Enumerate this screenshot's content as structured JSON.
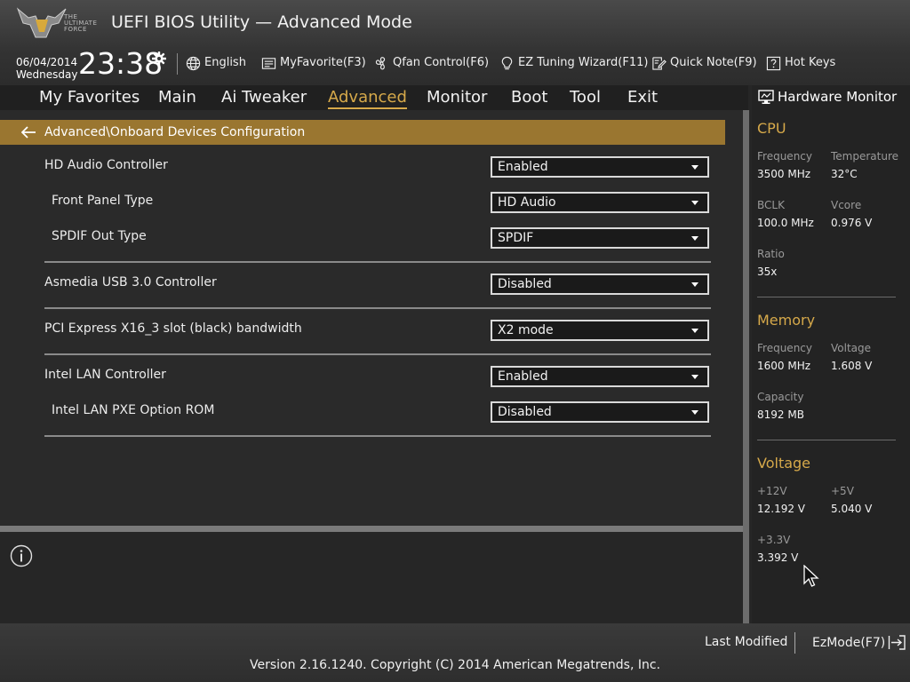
{
  "header": {
    "logo_text": [
      "THE",
      "ULTIMATE",
      "FORCE"
    ],
    "title": "UEFI BIOS Utility — Advanced Mode",
    "date": "06/04/2014",
    "weekday": "Wednesday",
    "time": "23:38",
    "buttons": {
      "language": "English",
      "myfavorite": "MyFavorite(F3)",
      "qfan": "Qfan Control(F6)",
      "ez_tuning": "EZ Tuning Wizard(F11)",
      "quick_note": "Quick Note(F9)",
      "hot_keys": "Hot Keys"
    }
  },
  "menu": [
    "My Favorites",
    "Main",
    "Ai Tweaker",
    "Advanced",
    "Monitor",
    "Boot",
    "Tool",
    "Exit"
  ],
  "active_menu": "Advanced",
  "breadcrumb": "Advanced\\Onboard Devices Configuration",
  "settings": [
    {
      "label": "HD Audio Controller",
      "value": "Enabled"
    },
    {
      "label": "Front Panel Type",
      "value": "HD Audio"
    },
    {
      "label": "SPDIF Out Type",
      "value": "SPDIF"
    },
    {
      "label": "Asmedia USB 3.0 Controller",
      "value": "Disabled"
    },
    {
      "label": "PCI Express X16_3 slot (black) bandwidth",
      "value": "X2 mode"
    },
    {
      "label": "Intel LAN Controller",
      "value": "Enabled"
    },
    {
      "label": "Intel LAN PXE Option ROM",
      "value": "Disabled"
    }
  ],
  "hw_monitor": {
    "title": "Hardware Monitor",
    "cpu": {
      "title": "CPU",
      "frequency_label": "Frequency",
      "frequency": "3500 MHz",
      "temperature_label": "Temperature",
      "temperature": "32°C",
      "bclk_label": "BCLK",
      "bclk": "100.0 MHz",
      "vcore_label": "Vcore",
      "vcore": "0.976 V",
      "ratio_label": "Ratio",
      "ratio": "35x"
    },
    "memory": {
      "title": "Memory",
      "frequency_label": "Frequency",
      "frequency": "1600 MHz",
      "voltage_label": "Voltage",
      "voltage": "1.608 V",
      "capacity_label": "Capacity",
      "capacity": "8192 MB"
    },
    "voltage": {
      "title": "Voltage",
      "v12_label": "+12V",
      "v12": "12.192 V",
      "v5_label": "+5V",
      "v5": "5.040 V",
      "v33_label": "+3.3V",
      "v33": "3.392 V"
    }
  },
  "footer": {
    "last_modified": "Last Modified",
    "ezmode": "EzMode(F7)",
    "copyright": "Version 2.16.1240. Copyright (C) 2014 American Megatrends, Inc."
  },
  "colors": {
    "accent": "#d6a94a",
    "breadcrumb_bg": "#9a7630",
    "background": "#262626"
  }
}
